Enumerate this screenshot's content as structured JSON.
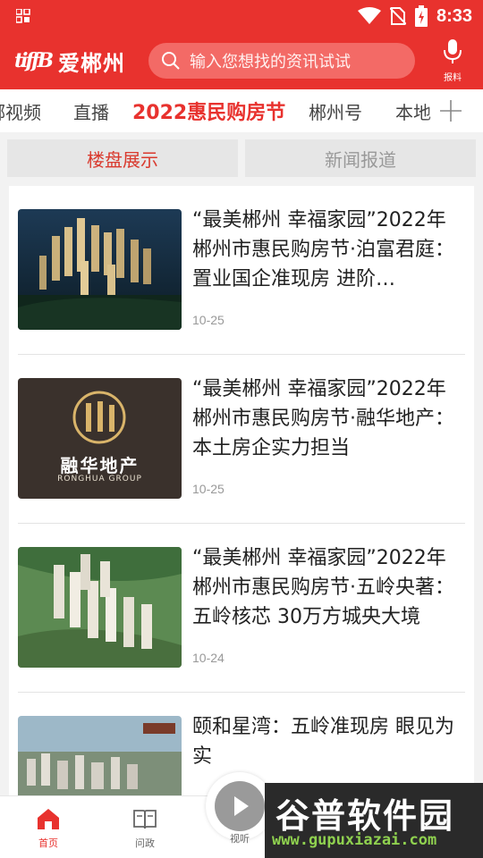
{
  "status_bar": {
    "time": "8:33"
  },
  "header": {
    "logo_mark": "tiffB",
    "logo_text": "爱郴州",
    "search_placeholder": "输入您想找的资讯试试",
    "report_label": "报料"
  },
  "channels": {
    "tabs": [
      "郴视频",
      "直播",
      "2022惠民购房节",
      "郴州号",
      "本地"
    ],
    "active_index": 2
  },
  "subtabs": {
    "items": [
      "楼盘展示",
      "新闻报道"
    ],
    "active_index": 0
  },
  "news": [
    {
      "title": "“最美郴州 幸福家园”2022年郴州市惠民购房节·泊富君庭：置业国企准现房 进阶…",
      "date": "10-25",
      "thumb": "residential-towers-night"
    },
    {
      "title": "“最美郴州 幸福家园”2022年郴州市惠民购房节·融华地产：本土房企实力担当",
      "date": "10-25",
      "thumb": "ronghua-logo",
      "thumb_text": "融华地产",
      "thumb_subtext": "RONGHUA GROUP"
    },
    {
      "title": "“最美郴州 幸福家园”2022年郴州市惠民购房节·五岭央著：五岭核芯 30万方城央大境",
      "date": "10-24",
      "thumb": "residential-towers-green"
    },
    {
      "title": "颐和星湾：五岭准现房 眼见为实",
      "date": "",
      "thumb": "city-aerial"
    }
  ],
  "bottom_nav": {
    "items": [
      {
        "label": "首页",
        "icon": "home-icon"
      },
      {
        "label": "问政",
        "icon": "book-icon"
      },
      {
        "label": "视听",
        "icon": "play-icon"
      }
    ],
    "active_index": 0
  },
  "watermark": {
    "title": "谷普软件园",
    "url": "www.gupuxiazai.com"
  },
  "colors": {
    "brand": "#e8322e",
    "text": "#222222",
    "muted": "#999999"
  }
}
